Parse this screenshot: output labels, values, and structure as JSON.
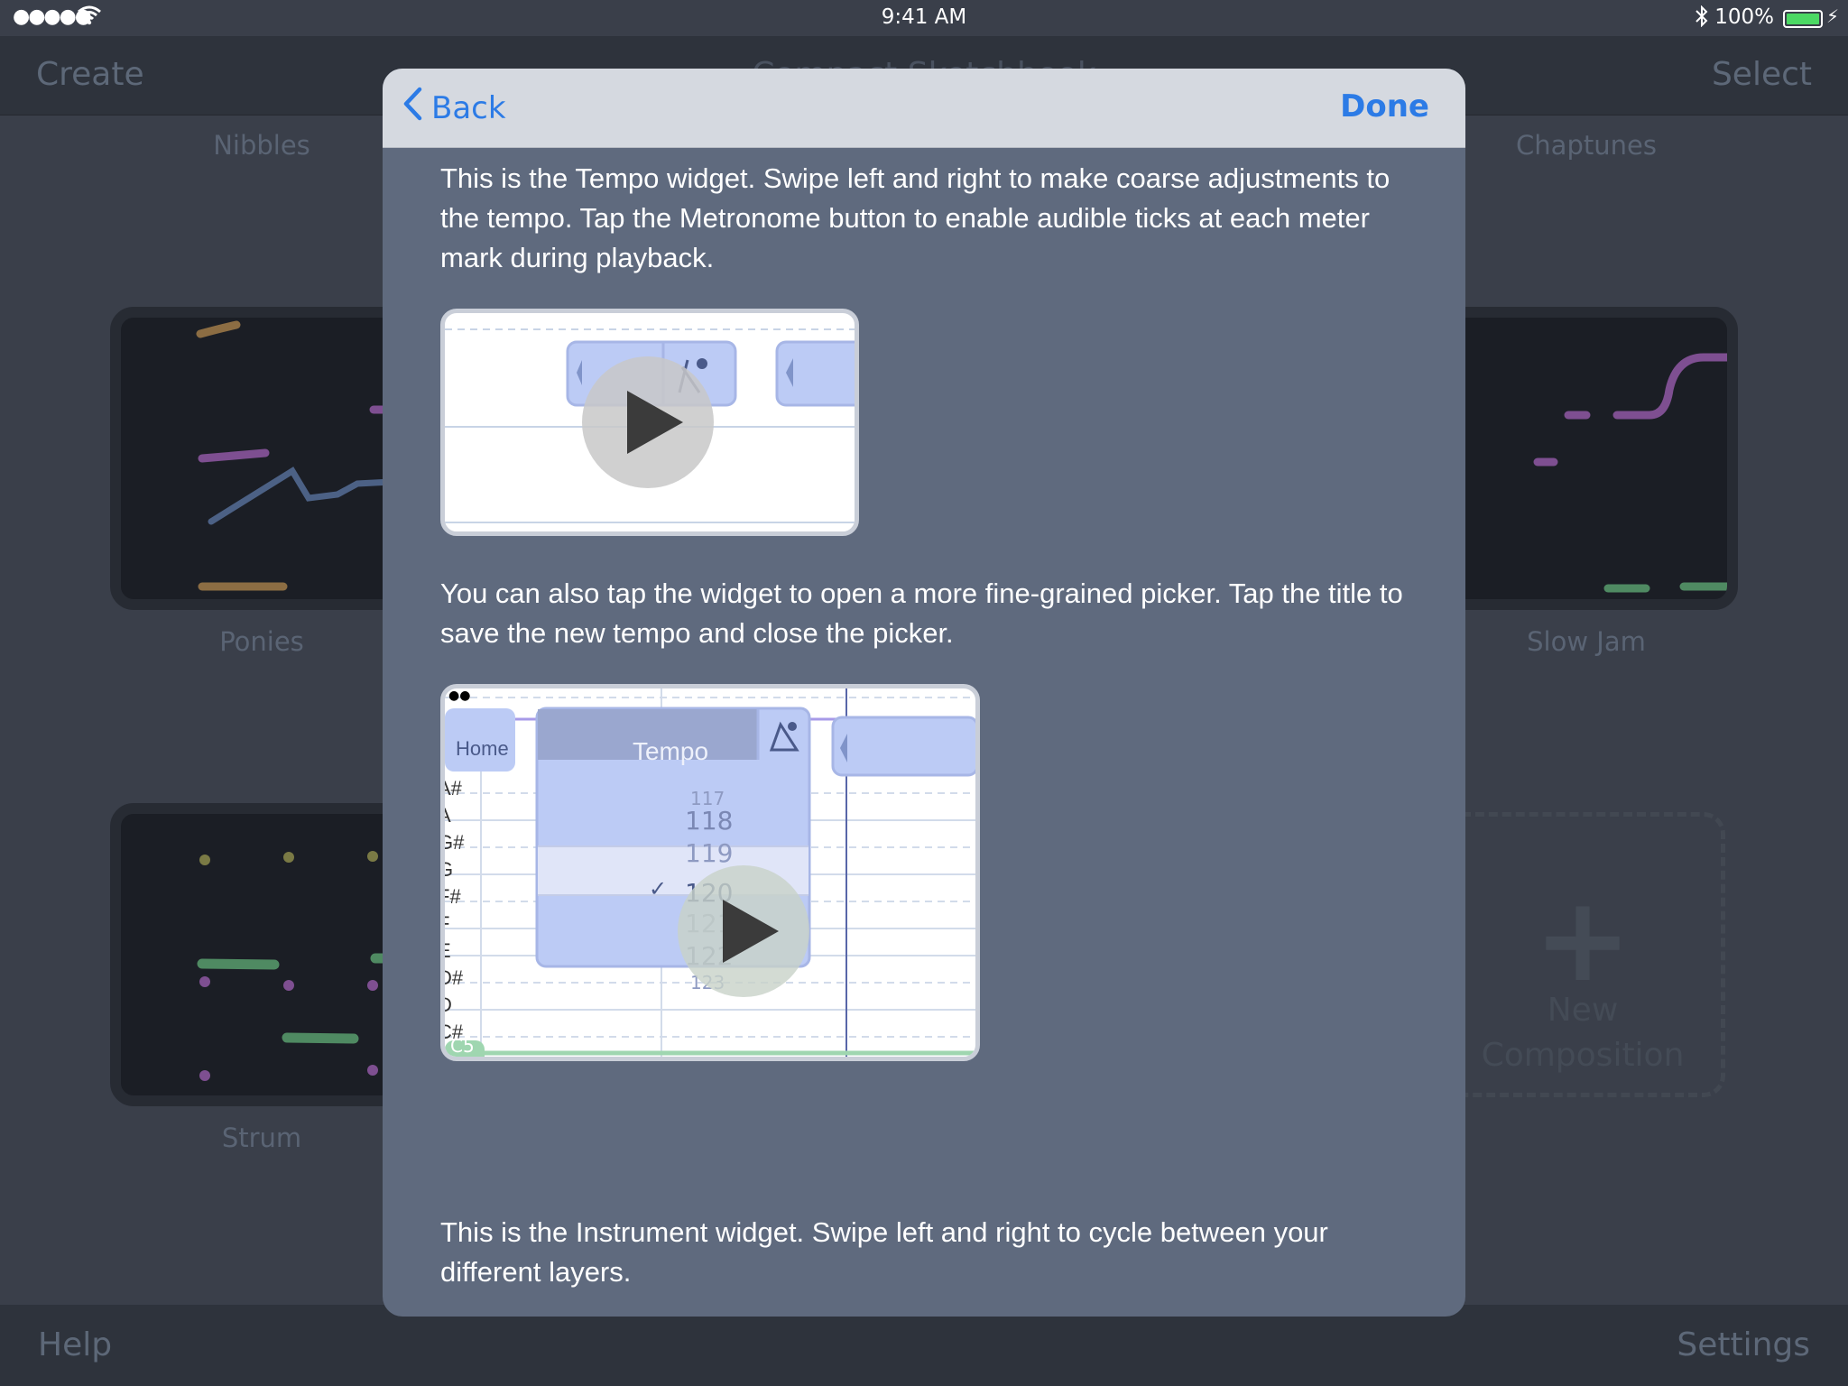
{
  "status_bar": {
    "signal": "●●●●●",
    "time": "9:41 AM",
    "battery": "100%"
  },
  "background": {
    "nav": {
      "left": "Create",
      "right": "Select",
      "title": "Compact Sketchbook"
    },
    "tiles": [
      "Nibbles",
      "Chaptunes",
      "Ponies",
      "Slow Jam",
      "Strum"
    ],
    "new_composition": "New Composition",
    "bottom": {
      "left": "Help",
      "right": "Settings"
    }
  },
  "modal": {
    "back_label": "Back",
    "done_label": "Done",
    "para1": "This is the Tempo widget. Swipe left and right to make coarse adjustments to the tempo. Tap the Metronome button to enable audible ticks at each meter mark during playback.",
    "para2": "You can also tap the widget to open a more fine-grained picker. Tap the title to save the new tempo and close the picker.",
    "para3": "This is the Instrument widget. Swipe left and right to cycle between your different layers.",
    "video2": {
      "home_label": "Home",
      "picker_title": "Tempo",
      "picker_values": [
        "117",
        "118",
        "119",
        "120",
        "121",
        "122",
        "123"
      ],
      "note_labels": [
        "A#",
        "A",
        "G#",
        "G",
        "F#",
        "F",
        "E",
        "D#",
        "D",
        "C#"
      ],
      "badge": "C5"
    }
  },
  "colors": {
    "accent": "#2c7be6",
    "modal_bg": "#5f6a7e",
    "app_bg": "#3a3f4a"
  }
}
